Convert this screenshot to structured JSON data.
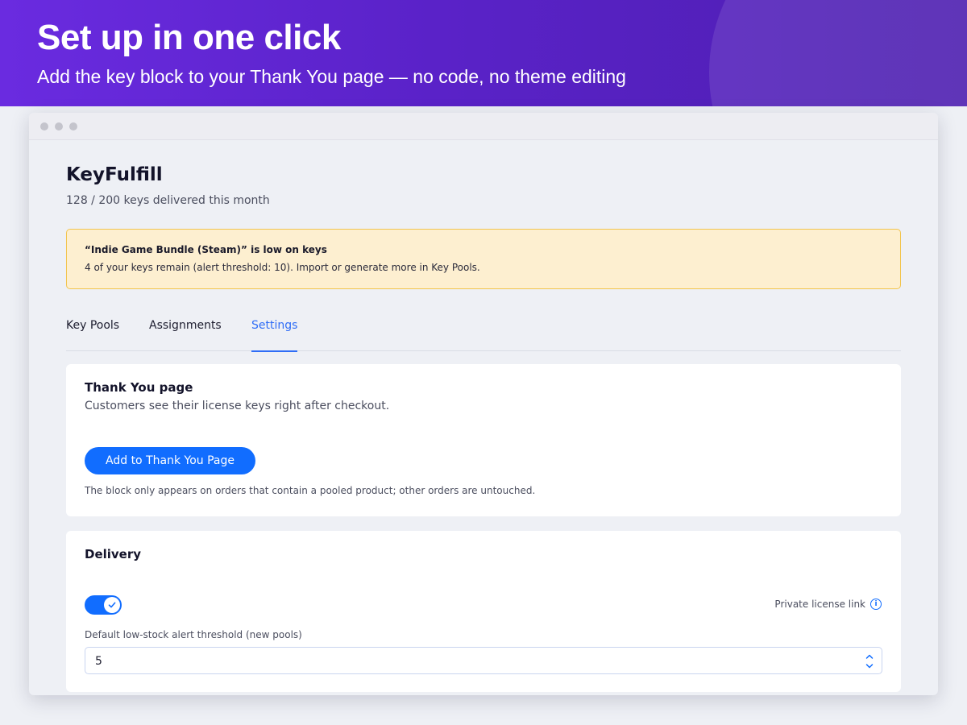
{
  "banner": {
    "title": "Set up in one click",
    "subtitle": "Add the key block to your Thank You page — no code, no theme editing"
  },
  "app": {
    "name": "KeyFulfill",
    "usage": "128 / 200 keys delivered this month"
  },
  "alert": {
    "title": "“Indie Game Bundle (Steam)” is low on keys",
    "message": "4 of your keys remain (alert threshold: 10). Import or generate more in Key Pools."
  },
  "tabs": [
    {
      "label": "Key Pools",
      "active": false
    },
    {
      "label": "Assignments",
      "active": false
    },
    {
      "label": "Settings",
      "active": true
    }
  ],
  "thank_you_card": {
    "title": "Thank You page",
    "description": "Customers see their license keys right after checkout.",
    "button_label": "Add to Thank You Page",
    "note": "The block only appears on orders that contain a pooled product; other orders are untouched."
  },
  "delivery_card": {
    "title": "Delivery",
    "toggle_on": true,
    "private_link_label": "Private license link",
    "threshold_label": "Default low-stock alert threshold (new pools)",
    "threshold_value": "5"
  },
  "colors": {
    "accent": "#116dff",
    "banner_gradient_start": "#6a2be0",
    "banner_gradient_end": "#4d1fb0",
    "alert_bg": "#fdefd0",
    "alert_border": "#f2c44d"
  },
  "icons": [
    "window-dot-icon",
    "info-icon",
    "check-icon",
    "chevron-up-down-icon"
  ]
}
